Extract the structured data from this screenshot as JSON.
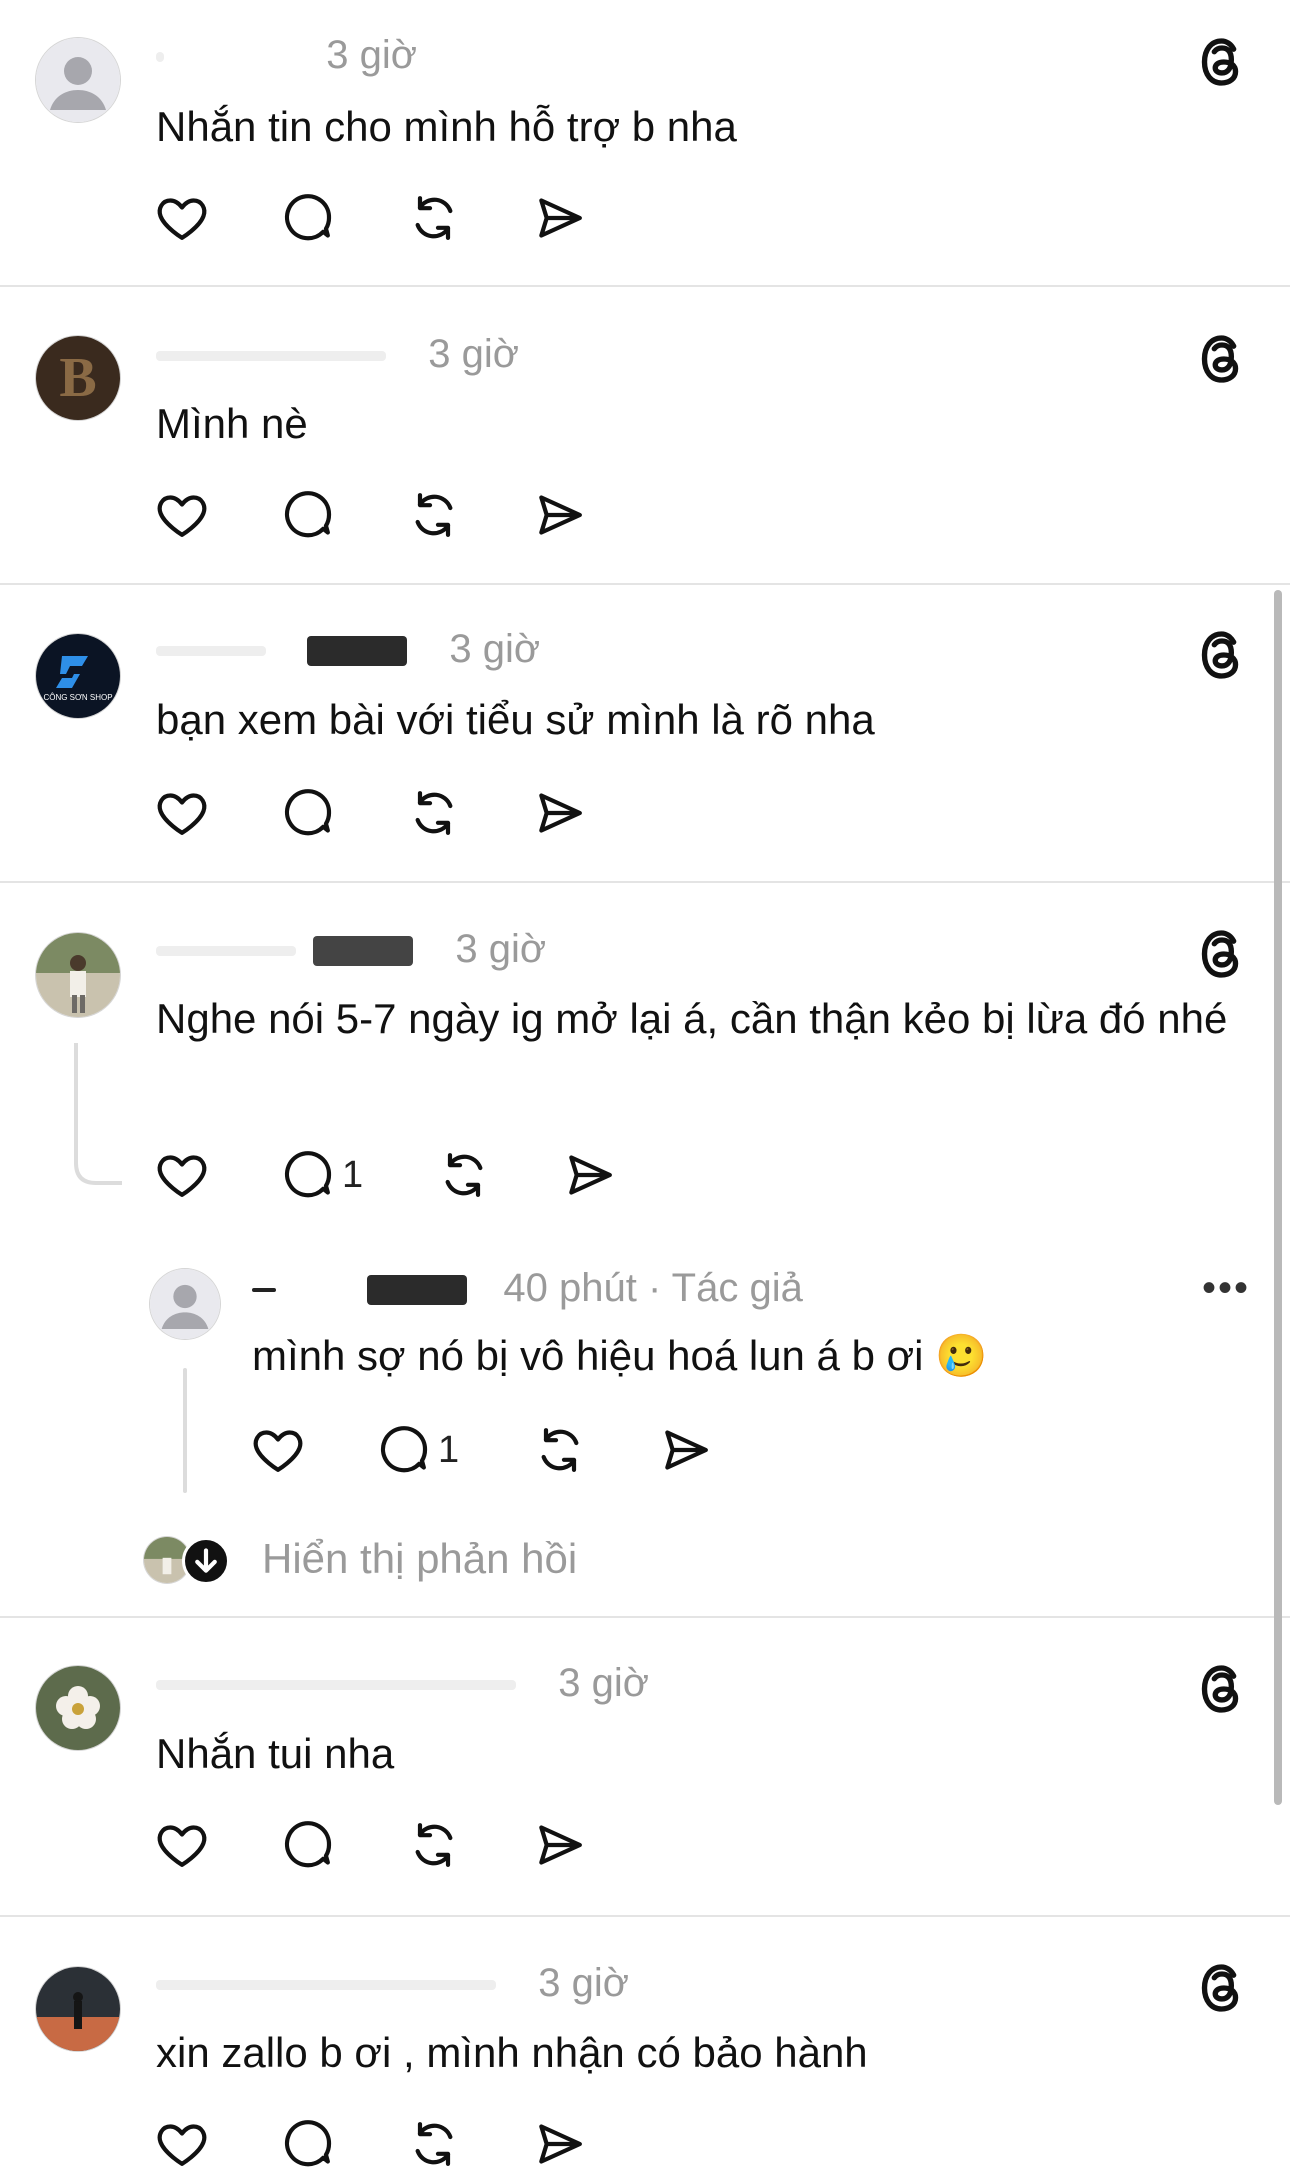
{
  "comments": [
    {
      "time": "3 giờ",
      "text": "Nhắn tin cho mình hỗ trợ b nha"
    },
    {
      "time": "3 giờ",
      "text": "Mình nè"
    },
    {
      "time": "3 giờ",
      "text": "bạn xem bài với tiểu sử mình là rõ nha",
      "avatar_text": "CÔNG SƠN SHOP"
    },
    {
      "time": "3 giờ",
      "text": "Nghe nói 5-7 ngày ig mở lại á, cần thận kẻo bị lừa đó nhé",
      "reply_count": "1"
    },
    {
      "time": "3 giờ",
      "text": "Nhắn tui nha"
    },
    {
      "time": "3 giờ",
      "text": "xin zallo b ơi , mình nhận có bảo hành"
    }
  ],
  "reply": {
    "time": "40 phút",
    "author_tag": "· Tác giả",
    "text": "mình sợ nó bị vô hiệu hoá lun á b ơi 🥲",
    "reply_count": "1",
    "more": "•••"
  },
  "show_replies": "Hiển thị phản hồi",
  "icons": [
    "like-icon",
    "comment-icon",
    "repost-icon",
    "share-icon",
    "threads-logo-icon",
    "more-icon"
  ],
  "colors": {
    "text": "#111111",
    "meta": "#9a9a9a",
    "divider": "#e4e4e4"
  }
}
